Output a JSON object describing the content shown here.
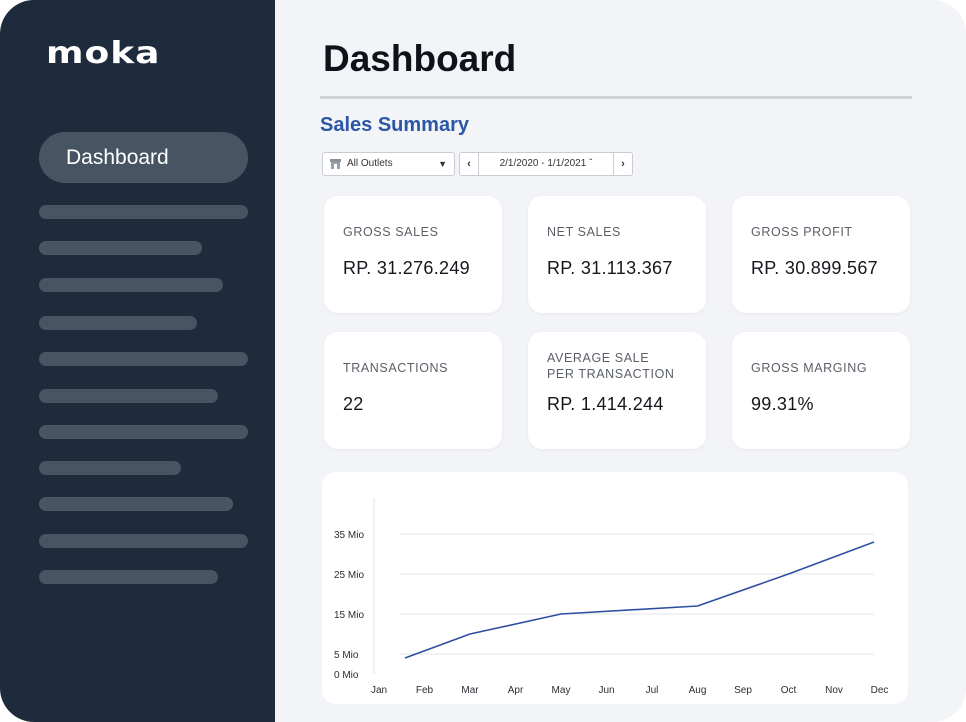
{
  "app": {
    "logo_text": "MOKA"
  },
  "sidebar": {
    "active_item": "Dashboard",
    "placeholder_count": 11
  },
  "header": {
    "title": "Dashboard"
  },
  "summary": {
    "title": "Sales Summary",
    "outlet_filter": "All Outlets",
    "date_range": "2/1/2020 - 1/1/2021"
  },
  "metrics": [
    {
      "label": "GROSS SALES",
      "value": "RP. 31.276.249"
    },
    {
      "label": "NET SALES",
      "value": "RP. 31.113.367"
    },
    {
      "label": "GROSS PROFIT",
      "value": "RP. 30.899.567"
    },
    {
      "label": "TRANSACTIONS",
      "value": "22"
    },
    {
      "label_line1": "AVERAGE SALE",
      "label_line2": "PER TRANSACTION",
      "value": "RP. 1.414.244"
    },
    {
      "label": "GROSS MARGING",
      "value": "99.31%"
    }
  ],
  "colors": {
    "sidebar_bg": "#1d2b3c",
    "accent": "#2c56a6",
    "line": "#2f4fa0"
  },
  "chart_data": {
    "type": "line",
    "title": "",
    "xlabel": "",
    "ylabel": "",
    "categories": [
      "Jan",
      "Feb",
      "Mar",
      "Apr",
      "May",
      "Jun",
      "Jul",
      "Aug",
      "Sep",
      "Oct",
      "Nov",
      "Dec"
    ],
    "y_ticks": [
      "0 Mio",
      "5 Mio",
      "15 Mio",
      "25 Mio",
      "35 Mio"
    ],
    "series": [
      {
        "x": [
          "Jan",
          "Mar",
          "May",
          "Aug",
          "Oct",
          "Dec"
        ],
        "values": [
          4,
          10,
          15,
          17,
          25,
          33
        ]
      }
    ],
    "grid": true,
    "legend": "none"
  }
}
